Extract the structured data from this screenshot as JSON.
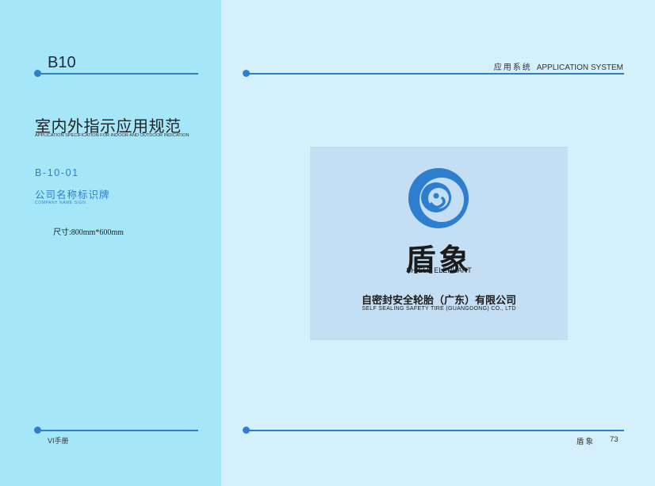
{
  "header": {
    "code": "B10",
    "system_cn": "应用系统",
    "system_en": "APPLICATION SYSTEM"
  },
  "section": {
    "title_cn": "室内外指示应用规范",
    "title_en": "APPLICATION SPECIFICATION FOR INDOOR AND OUTDOOR INDICATION"
  },
  "item": {
    "code": "B-10-01",
    "title_cn": "公司名称标识牌",
    "title_en": "COMPANY NAME SIGN",
    "size": "尺寸:800mm*600mm"
  },
  "sign": {
    "brand_cn": "盾象",
    "brand_en": "SHIELD ELEPHANT",
    "company_cn": "自密封安全轮胎（广东）有限公司",
    "company_en": "SELF SEALING SAFETY TIRE (GUANGDONG) CO., LTD",
    "logo_icon": "shield-elephant-logo",
    "bg_color": "#c4dff4",
    "logo_color": "#2e7ed0"
  },
  "footer": {
    "manual": "VI手册",
    "brand": "盾象",
    "page": "73"
  },
  "colors": {
    "left_panel": "#a6e6f9",
    "right_panel": "#d4f1fb",
    "accent": "#2e7ed0"
  }
}
